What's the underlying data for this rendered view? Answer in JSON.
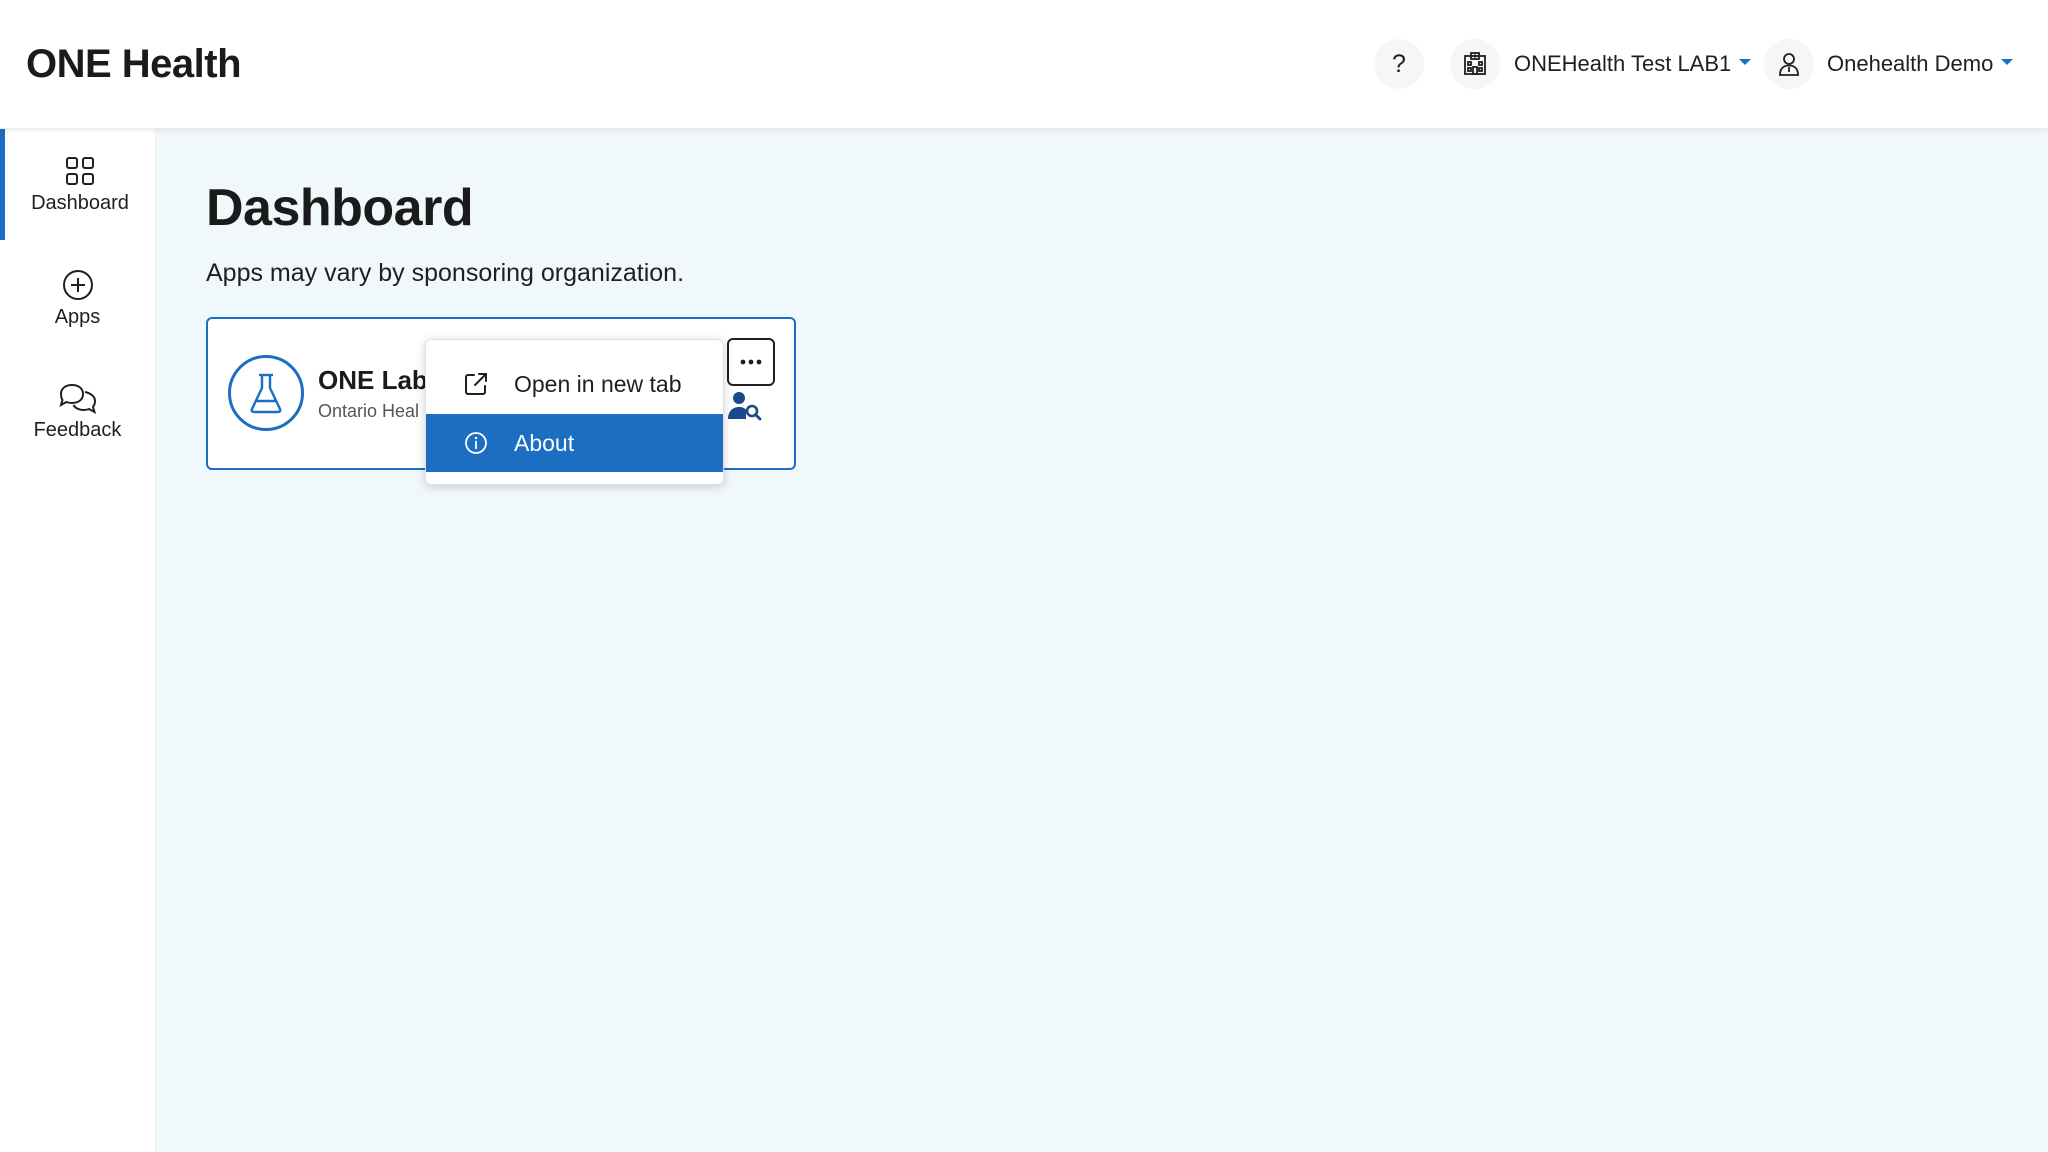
{
  "header": {
    "brand": "ONE Health",
    "help_label": "?",
    "org_name": "ONEHealth Test LAB1",
    "user_name": "Onehealth Demo"
  },
  "sidebar": {
    "items": [
      {
        "label": "Dashboard",
        "icon": "grid-icon",
        "active": true
      },
      {
        "label": "Apps",
        "icon": "plus-circle-icon",
        "active": false
      },
      {
        "label": "Feedback",
        "icon": "chat-bubbles-icon",
        "active": false
      }
    ]
  },
  "main": {
    "title": "Dashboard",
    "subtitle": "Apps may vary by sponsoring organization.",
    "apps": [
      {
        "name": "ONE Lab",
        "org": "Ontario Heal",
        "icon": "flask-icon"
      }
    ]
  },
  "context_menu": {
    "items": [
      {
        "label": "Open in new tab",
        "icon": "external-link-icon",
        "selected": false
      },
      {
        "label": "About",
        "icon": "info-icon",
        "selected": true
      }
    ]
  },
  "colors": {
    "accent": "#1b6ec2",
    "main_background": "#f1f8fc"
  }
}
